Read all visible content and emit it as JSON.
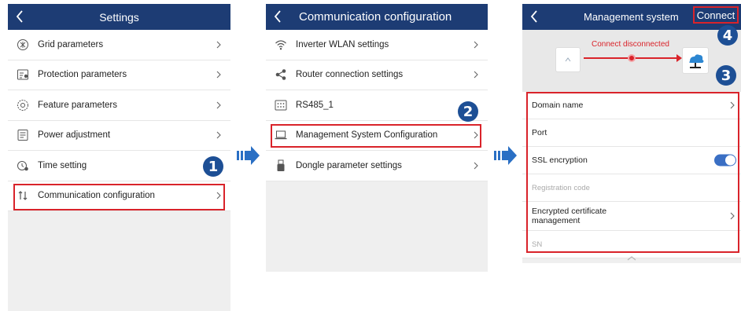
{
  "panel1": {
    "title": "Settings",
    "items": [
      {
        "label": "Grid parameters",
        "icon": "grid-icon"
      },
      {
        "label": "Protection parameters",
        "icon": "protection-icon"
      },
      {
        "label": "Feature parameters",
        "icon": "feature-icon"
      },
      {
        "label": "Power adjustment",
        "icon": "power-adjust-icon"
      },
      {
        "label": "Time setting",
        "icon": "clock-icon"
      },
      {
        "label": "Communication configuration",
        "icon": "communication-icon"
      }
    ]
  },
  "panel2": {
    "title": "Communication configuration",
    "items": [
      {
        "label": "Inverter WLAN settings",
        "icon": "wifi-icon"
      },
      {
        "label": "Router connection settings",
        "icon": "share-icon"
      },
      {
        "label": "RS485_1",
        "icon": "rs485-icon"
      },
      {
        "label": "Management System Configuration",
        "icon": "laptop-icon"
      },
      {
        "label": "Dongle parameter settings",
        "icon": "dongle-icon"
      }
    ]
  },
  "panel3": {
    "title": "Management system",
    "connect_label": "Connect",
    "status_text": "Connect disconnected",
    "fields": [
      {
        "label": "Domain name"
      },
      {
        "label": "Port"
      },
      {
        "label": "SSL encryption",
        "toggle": true
      },
      {
        "label": "Registration code",
        "placeholder": true
      },
      {
        "label": "Encrypted certificate management"
      },
      {
        "label": "SN",
        "placeholder": true
      }
    ]
  },
  "badges": [
    "1",
    "2",
    "3",
    "4"
  ],
  "colors": {
    "header": "#1d3c74",
    "highlight": "#d9232a",
    "badge": "#1d4f95",
    "arrow": "#2a6fc4"
  }
}
